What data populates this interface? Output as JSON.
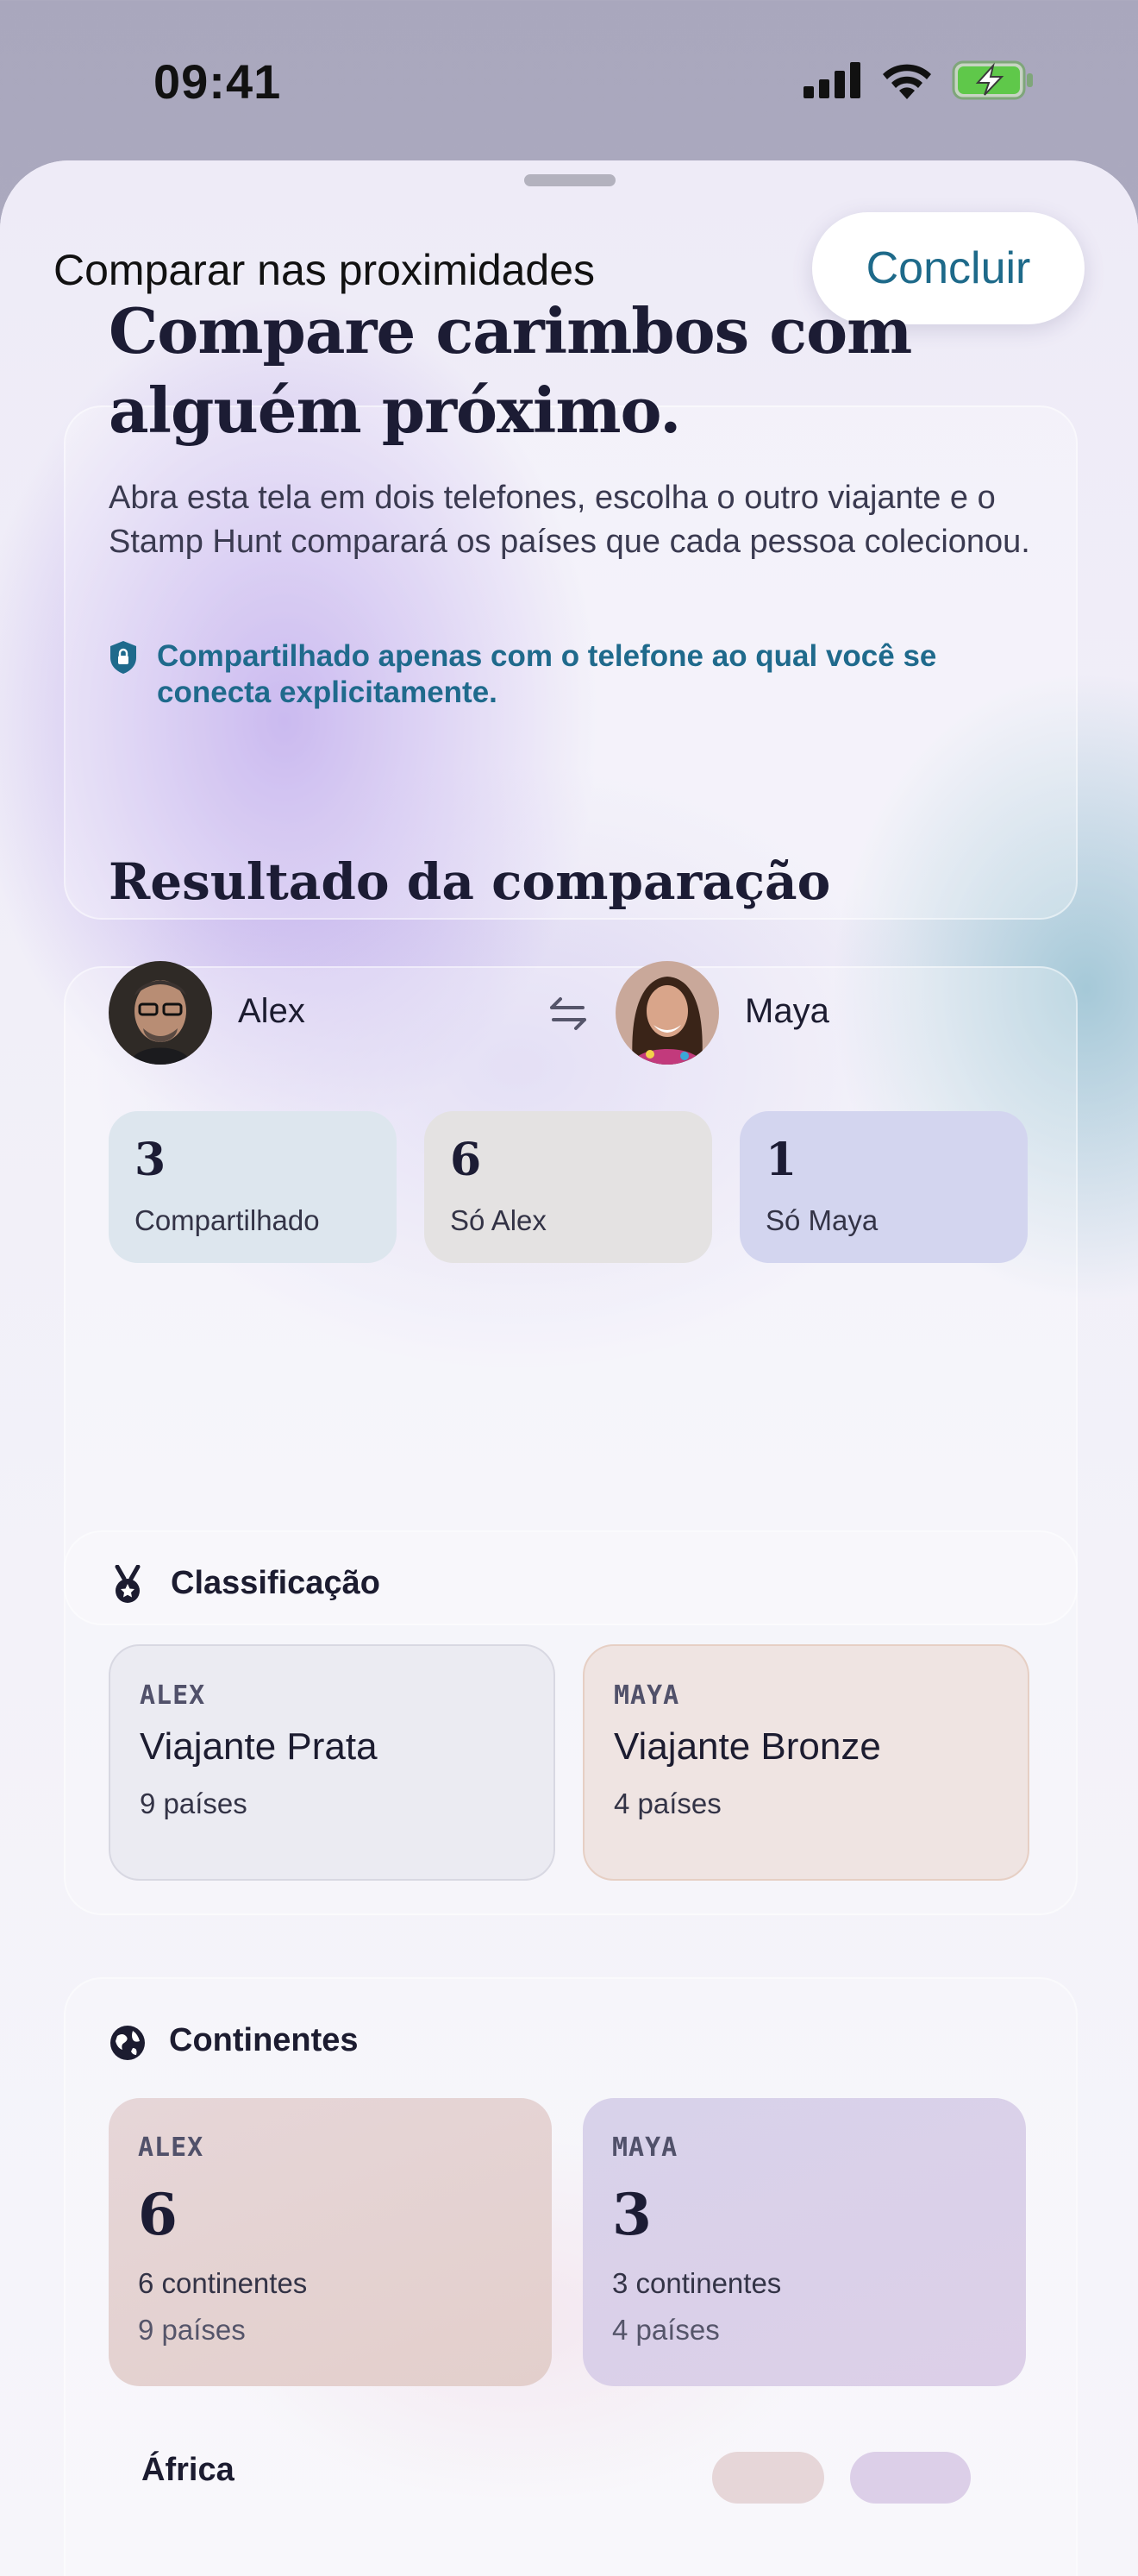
{
  "status_bar": {
    "time": "09:41"
  },
  "sheet": {
    "title": "Comparar nas proximidades",
    "done_label": "Concluir"
  },
  "hero": {
    "heading_line1": "Compare carimbos com",
    "heading_line2": "alguém próximo.",
    "body": "Abra esta tela em dois telefones, escolha o outro viajante e o Stamp Hunt comparará os países que cada pessoa colecionou.",
    "privacy_note": "Compartilhado apenas com o telefone ao qual você se conecta explicitamente."
  },
  "result": {
    "title": "Resultado da comparação",
    "person_a": "Alex",
    "person_b": "Maya",
    "stats": [
      {
        "value": "3",
        "label": "Compartilhado"
      },
      {
        "value": "6",
        "label": "Só Alex"
      },
      {
        "value": "1",
        "label": "Só Maya"
      }
    ]
  },
  "ranking": {
    "title": "Classificação",
    "cards": [
      {
        "tag": "ALEX",
        "title": "Viajante Prata",
        "sub": "9 países"
      },
      {
        "tag": "MAYA",
        "title": "Viajante Bronze",
        "sub": "4 países"
      }
    ]
  },
  "continents": {
    "title": "Continentes",
    "cards": [
      {
        "tag": "ALEX",
        "value": "6",
        "line1": "6 continentes",
        "line2": "9 países"
      },
      {
        "tag": "MAYA",
        "value": "3",
        "line1": "3 continentes",
        "line2": "4 países"
      }
    ],
    "next_label": "África"
  },
  "colors": {
    "accent": "#1e6a8a",
    "shared_tile": "#dde6ee",
    "only_a_tile": "#e4e2e2",
    "only_b_tile": "#d3d5ef",
    "silver_card": "#ebebf2",
    "bronze_card": "#efe4e2"
  }
}
